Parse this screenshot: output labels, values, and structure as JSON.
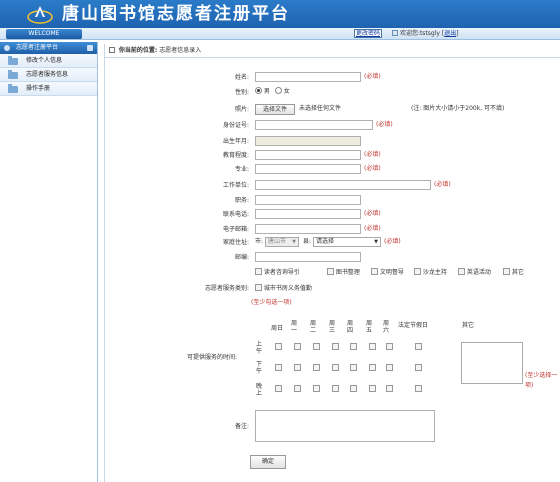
{
  "header": {
    "title": "唐山图书馆志愿者注册平台",
    "welcome": "WELCOME"
  },
  "toplinks": {
    "change_password": "更改密码",
    "welcome_text": "欢迎您:tstsgly",
    "logout": "退出"
  },
  "sidebar": {
    "title": "志愿者注册平台",
    "items": [
      {
        "label": "修改个人信息"
      },
      {
        "label": "志愿者服务信息"
      },
      {
        "label": "操作手册"
      }
    ]
  },
  "breadcrumb": {
    "label": "你当前的位置:",
    "value": "志愿者信息录入"
  },
  "form": {
    "name": {
      "label": "姓名:",
      "value": "",
      "required": "(必填)"
    },
    "gender": {
      "label": "性别:",
      "male": "男",
      "female": "女",
      "selected": "男"
    },
    "photo": {
      "label": "照片:",
      "button": "选择文件",
      "status": "未选择任何文件",
      "note": "(注: 图片大小请小于200k, 可不填)"
    },
    "id_number": {
      "label": "身份证号:",
      "value": "",
      "required": "(必填)"
    },
    "birth": {
      "label": "出生年月:",
      "value": ""
    },
    "education": {
      "label": "教育程度:",
      "value": "",
      "required": "(必填)"
    },
    "major": {
      "label": "专业:",
      "value": "",
      "required": "(必填)"
    },
    "workplace": {
      "label": "工作单位:",
      "value": "",
      "required": "(必填)"
    },
    "position": {
      "label": "职务:",
      "value": ""
    },
    "phone": {
      "label": "联系电话:",
      "value": "",
      "required": "(必填)"
    },
    "email": {
      "label": "电子邮箱:",
      "value": "",
      "required": "(必填)"
    },
    "address": {
      "label": "家庭住址:",
      "city_prefix": "市:",
      "city": "唐山市",
      "district_prefix": "县:",
      "district": "请选择",
      "required": "(必填)"
    },
    "zipcode": {
      "label": "邮编:",
      "value": ""
    },
    "service_type": {
      "label": "志愿者服务类别:",
      "options": [
        "读者咨询导引",
        "图书整理",
        "文明督导",
        "沙龙主持",
        "英语活动",
        "其它",
        "城市书房义务值勤"
      ],
      "hint": "(至少勾选一项)"
    },
    "service_time": {
      "label": "可提供服务的时间:",
      "days": [
        "周日",
        "周一",
        "周二",
        "周三",
        "周四",
        "周五",
        "周六"
      ],
      "legal_holiday": "法定节假日",
      "other": "其它",
      "slots": [
        "上午",
        "下午",
        "晚上"
      ],
      "hint": "(至少选择一项)"
    },
    "remark": {
      "label": "备注:",
      "value": ""
    },
    "submit": "确定"
  }
}
